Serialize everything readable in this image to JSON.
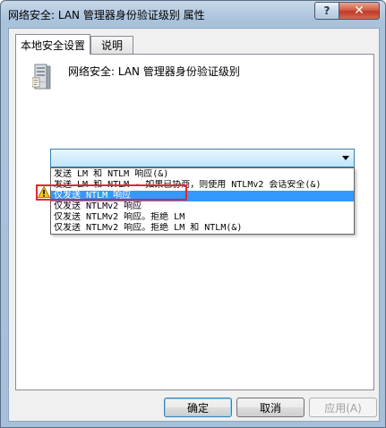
{
  "window": {
    "title": "网络安全: LAN 管理器身份验证级别 属性",
    "help_label": "?",
    "close_label": "✕"
  },
  "tabs": [
    {
      "label": "本地安全设置"
    },
    {
      "label": "说明"
    }
  ],
  "policy": {
    "title": "网络安全: LAN 管理器身份验证级别",
    "icon": "server-icon"
  },
  "dropdown": {
    "selected": "",
    "options": [
      {
        "label": "发送 LM 和 NTLM 响应(&)"
      },
      {
        "label": "发送 LM 和 NTLM - 如果已协商，则使用 NTLMv2 会话安全(&)"
      },
      {
        "label": "仅发送 NTLM 响应"
      },
      {
        "label": "仅发送 NTLMv2 响应"
      },
      {
        "label": "仅发送 NTLMv2 响应。拒绝 LM"
      },
      {
        "label": "仅发送 NTLMv2 响应。拒绝 LM 和 NTLM(&)"
      }
    ],
    "highlighted_index": 2
  },
  "annotation": {
    "icon": "warning-icon",
    "box_color": "#e8242a"
  },
  "buttons": {
    "ok": "确定",
    "cancel": "取消",
    "apply": "应用(A)"
  },
  "colors": {
    "selection": "#3399ff",
    "close_button": "#c0382a"
  }
}
